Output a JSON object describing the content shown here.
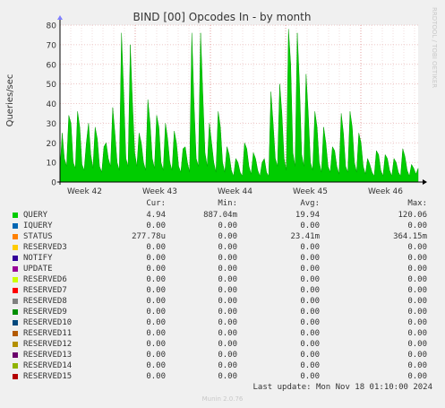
{
  "title": "BIND [00] Opcodes In - by month",
  "watermark": "RRDTOOL / TOBI OETIKER",
  "chart_data": {
    "type": "area",
    "title": "BIND [00] Opcodes In - by month",
    "ylabel": "Queries/sec",
    "ylim": [
      0,
      80
    ],
    "yticks": [
      0,
      10,
      20,
      30,
      40,
      50,
      60,
      70,
      80
    ],
    "xticks": [
      "Week 42",
      "Week 43",
      "Week 44",
      "Week 45",
      "Week 46"
    ],
    "grid": true,
    "series": [
      {
        "name": "QUERY",
        "color": "#00cc00",
        "values": [
          6,
          25,
          12,
          8,
          34,
          30,
          10,
          7,
          36,
          28,
          9,
          6,
          20,
          30,
          14,
          7,
          28,
          22,
          8,
          5,
          18,
          20,
          12,
          8,
          38,
          25,
          10,
          6,
          76,
          45,
          12,
          8,
          70,
          40,
          15,
          8,
          25,
          20,
          10,
          6,
          42,
          30,
          12,
          7,
          34,
          28,
          10,
          6,
          30,
          22,
          10,
          6,
          26,
          20,
          8,
          5,
          17,
          18,
          10,
          5,
          76,
          40,
          12,
          8,
          76,
          45,
          15,
          8,
          30,
          20,
          10,
          5,
          36,
          28,
          10,
          5,
          18,
          14,
          6,
          3,
          12,
          10,
          5,
          3,
          20,
          17,
          8,
          4,
          15,
          12,
          6,
          3,
          10,
          12,
          5,
          3,
          46,
          30,
          12,
          8,
          50,
          35,
          12,
          6,
          78,
          60,
          15,
          8,
          76,
          50,
          14,
          8,
          55,
          35,
          10,
          6,
          36,
          28,
          10,
          5,
          28,
          20,
          8,
          5,
          18,
          16,
          8,
          4,
          35,
          25,
          8,
          5,
          36,
          28,
          10,
          5,
          25,
          20,
          8,
          4,
          12,
          9,
          5,
          3,
          16,
          14,
          6,
          3,
          14,
          12,
          6,
          3,
          12,
          10,
          5,
          3,
          17,
          13,
          6,
          3,
          9,
          7,
          4,
          7
        ]
      }
    ]
  },
  "legend": {
    "headers": {
      "cur": "Cur:",
      "min": "Min:",
      "avg": "Avg:",
      "max": "Max:"
    },
    "rows": [
      {
        "name": "QUERY",
        "color": "#00cc00",
        "cur": "4.94",
        "min": "887.04m",
        "avg": "19.94",
        "max": "120.06"
      },
      {
        "name": "IQUERY",
        "color": "#0066b3",
        "cur": "0.00",
        "min": "0.00",
        "avg": "0.00",
        "max": "0.00"
      },
      {
        "name": "STATUS",
        "color": "#ff8000",
        "cur": "277.78u",
        "min": "0.00",
        "avg": "23.41m",
        "max": "364.15m"
      },
      {
        "name": "RESERVED3",
        "color": "#ffcc00",
        "cur": "0.00",
        "min": "0.00",
        "avg": "0.00",
        "max": "0.00"
      },
      {
        "name": "NOTIFY",
        "color": "#330099",
        "cur": "0.00",
        "min": "0.00",
        "avg": "0.00",
        "max": "0.00"
      },
      {
        "name": "UPDATE",
        "color": "#990099",
        "cur": "0.00",
        "min": "0.00",
        "avg": "0.00",
        "max": "0.00"
      },
      {
        "name": "RESERVED6",
        "color": "#ccff00",
        "cur": "0.00",
        "min": "0.00",
        "avg": "0.00",
        "max": "0.00"
      },
      {
        "name": "RESERVED7",
        "color": "#ff0000",
        "cur": "0.00",
        "min": "0.00",
        "avg": "0.00",
        "max": "0.00"
      },
      {
        "name": "RESERVED8",
        "color": "#808080",
        "cur": "0.00",
        "min": "0.00",
        "avg": "0.00",
        "max": "0.00"
      },
      {
        "name": "RESERVED9",
        "color": "#008f00",
        "cur": "0.00",
        "min": "0.00",
        "avg": "0.00",
        "max": "0.00"
      },
      {
        "name": "RESERVED10",
        "color": "#00487d",
        "cur": "0.00",
        "min": "0.00",
        "avg": "0.00",
        "max": "0.00"
      },
      {
        "name": "RESERVED11",
        "color": "#b35a00",
        "cur": "0.00",
        "min": "0.00",
        "avg": "0.00",
        "max": "0.00"
      },
      {
        "name": "RESERVED12",
        "color": "#b38f00",
        "cur": "0.00",
        "min": "0.00",
        "avg": "0.00",
        "max": "0.00"
      },
      {
        "name": "RESERVED13",
        "color": "#6b006b",
        "cur": "0.00",
        "min": "0.00",
        "avg": "0.00",
        "max": "0.00"
      },
      {
        "name": "RESERVED14",
        "color": "#8fb300",
        "cur": "0.00",
        "min": "0.00",
        "avg": "0.00",
        "max": "0.00"
      },
      {
        "name": "RESERVED15",
        "color": "#b30000",
        "cur": "0.00",
        "min": "0.00",
        "avg": "0.00",
        "max": "0.00"
      }
    ]
  },
  "footer": {
    "last_update": "Last update: Mon Nov 18 01:10:00 2024",
    "munin_version": "Munin 2.0.76"
  }
}
